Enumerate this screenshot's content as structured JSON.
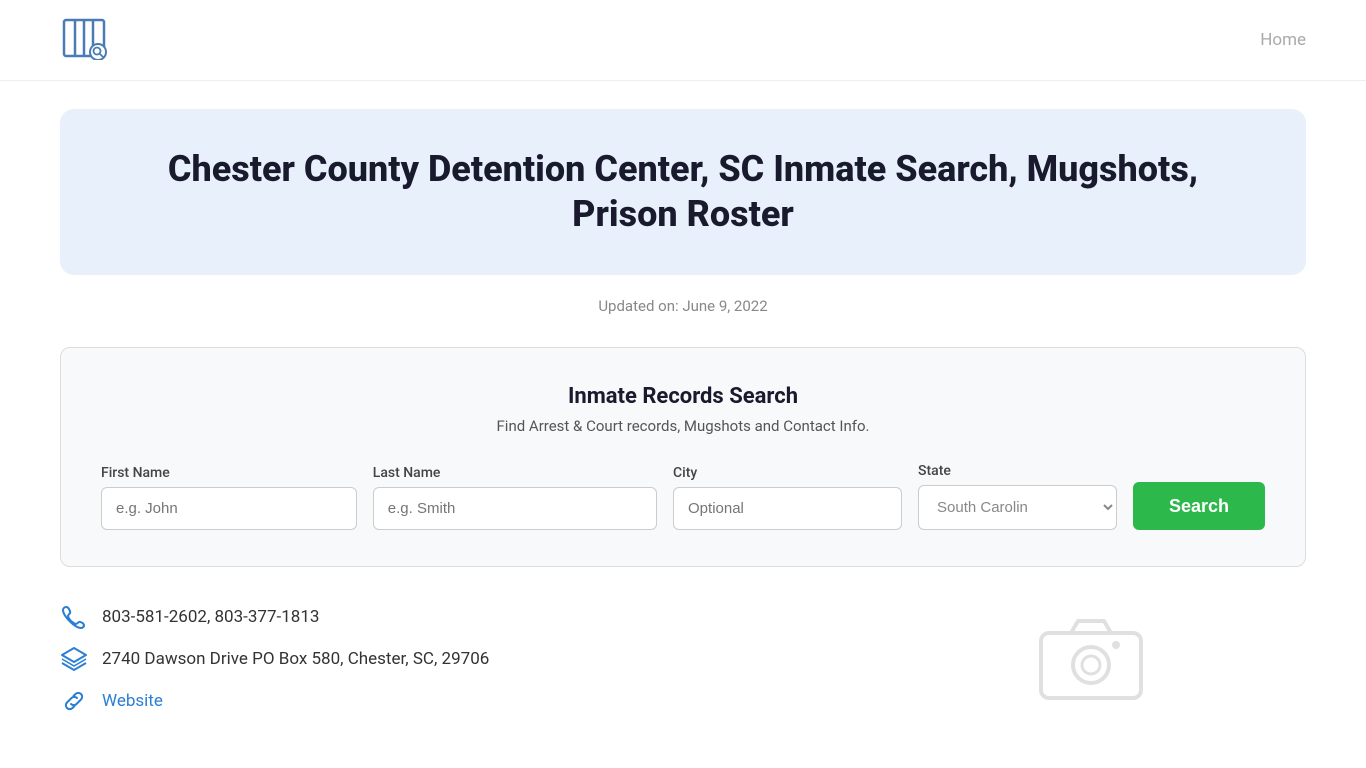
{
  "header": {
    "home_label": "Home"
  },
  "hero": {
    "title": "Chester County Detention Center, SC Inmate Search, Mugshots, Prison Roster",
    "updated_label": "Updated on: June 9, 2022"
  },
  "search_card": {
    "title": "Inmate Records Search",
    "subtitle": "Find Arrest & Court records, Mugshots and Contact Info.",
    "fields": {
      "first_name_label": "First Name",
      "first_name_placeholder": "e.g. John",
      "last_name_label": "Last Name",
      "last_name_placeholder": "e.g. Smith",
      "city_label": "City",
      "city_placeholder": "Optional",
      "state_label": "State",
      "state_value": "South Carolina"
    },
    "search_button_label": "Search"
  },
  "contact": {
    "phones": "803-581-2602, 803-377-1813",
    "address": "2740 Dawson Drive PO Box 580, Chester, SC, 29706",
    "website_label": "Website"
  }
}
